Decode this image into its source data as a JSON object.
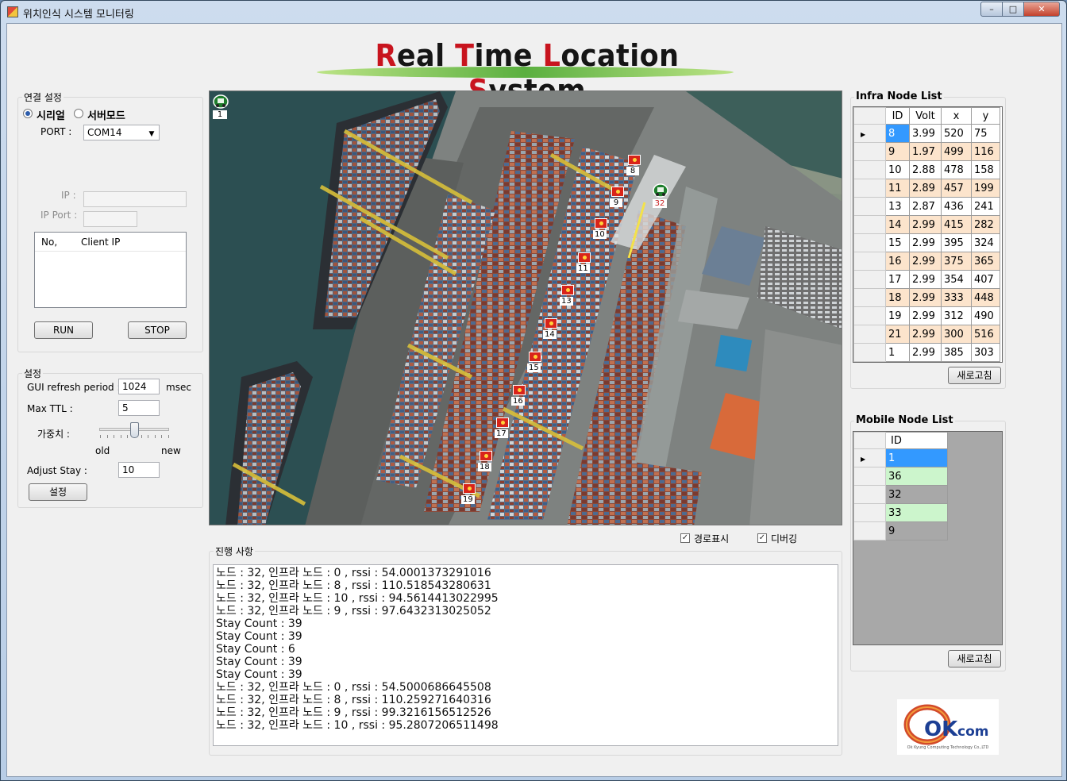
{
  "window": {
    "title": "위치인식 시스템 모니터링",
    "controls": {
      "minimize": "–",
      "maximize": "□",
      "close": "✕"
    }
  },
  "banner": {
    "parts": [
      {
        "cap": "R",
        "rest": "eal "
      },
      {
        "cap": "T",
        "rest": "ime "
      },
      {
        "cap": "L",
        "rest": "ocation "
      },
      {
        "cap": "S",
        "rest": "ystem"
      }
    ]
  },
  "connection": {
    "caption": "연결 설정",
    "serial_label": "시리얼",
    "server_label": "서버모드",
    "selected": "serial",
    "port_label": "PORT :",
    "port_value": "COM14",
    "ip_label": "IP :",
    "ip_port_label": "IP Port :",
    "ip_value": "",
    "ip_port_value": "",
    "client_list": {
      "col_no": "No,",
      "col_ip": "Client IP",
      "rows": []
    },
    "run_label": "RUN",
    "stop_label": "STOP"
  },
  "settings": {
    "caption": "설정",
    "gui_refresh_label": "GUI refresh period :",
    "gui_refresh_value": "1024",
    "gui_refresh_unit": "msec",
    "max_ttl_label": "Max TTL  :",
    "max_ttl_value": "5",
    "weight_label": "가중치  :",
    "weight_fraction": 0.5,
    "old_label": "old",
    "new_label": "new",
    "adjust_stay_label": "Adjust Stay :",
    "adjust_stay_value": "10",
    "apply_label": "설정"
  },
  "map": {
    "infra_markers": [
      "8",
      "9",
      "10",
      "11",
      "13",
      "14",
      "15",
      "16",
      "17",
      "18",
      "19"
    ],
    "mobile_markers": [
      "1",
      "32"
    ]
  },
  "options": {
    "show_path_label": "경로표시",
    "show_path_checked": true,
    "debug_label": "디버깅",
    "debug_checked": true
  },
  "progress": {
    "caption": "진행 사항",
    "lines": [
      "노드 : 32, 인프라 노드 : 0 , rssi : 54.0001373291016",
      "노드 : 32, 인프라 노드 : 8 , rssi : 110.518543280631",
      "노드 : 32, 인프라 노드 : 10 , rssi : 94.5614413022995",
      "노드 : 32, 인프라 노드 : 9 , rssi : 97.6432313025052",
      "Stay Count : 39",
      "Stay Count : 39",
      "Stay Count : 6",
      "Stay Count : 39",
      "Stay Count : 39",
      "노드 : 32, 인프라 노드 : 0 , rssi : 54.5000686645508",
      "노드 : 32, 인프라 노드 : 8 , rssi : 110.259271640316",
      "노드 : 32, 인프라 노드 : 9 , rssi : 99.3216156512526",
      "노드 : 32, 인프라 노드 : 10 , rssi : 95.2807206511498"
    ]
  },
  "infra_list": {
    "caption": "Infra Node List",
    "columns": [
      "ID",
      "Volt",
      "x",
      "y"
    ],
    "rows": [
      [
        "8",
        "3.99",
        "520",
        "75"
      ],
      [
        "9",
        "1.97",
        "499",
        "116"
      ],
      [
        "10",
        "2.88",
        "478",
        "158"
      ],
      [
        "11",
        "2.89",
        "457",
        "199"
      ],
      [
        "13",
        "2.87",
        "436",
        "241"
      ],
      [
        "14",
        "2.99",
        "415",
        "282"
      ],
      [
        "15",
        "2.99",
        "395",
        "324"
      ],
      [
        "16",
        "2.99",
        "375",
        "365"
      ],
      [
        "17",
        "2.99",
        "354",
        "407"
      ],
      [
        "18",
        "2.99",
        "333",
        "448"
      ],
      [
        "19",
        "2.99",
        "312",
        "490"
      ],
      [
        "21",
        "2.99",
        "300",
        "516"
      ],
      [
        "1",
        "2.99",
        "385",
        "303"
      ]
    ],
    "refresh_label": "새로고침",
    "alt_row_color": "#fce4cc"
  },
  "mobile_list": {
    "caption": "Mobile Node List",
    "columns": [
      "ID"
    ],
    "rows": [
      "1",
      "36",
      "32",
      "33",
      "9"
    ],
    "refresh_label": "새로고침",
    "alt_row_color": "#ccf5cc"
  },
  "logo": {
    "text": "OKcom",
    "tagline": "Ok Kyung Computing Technology Co.,LTD"
  }
}
